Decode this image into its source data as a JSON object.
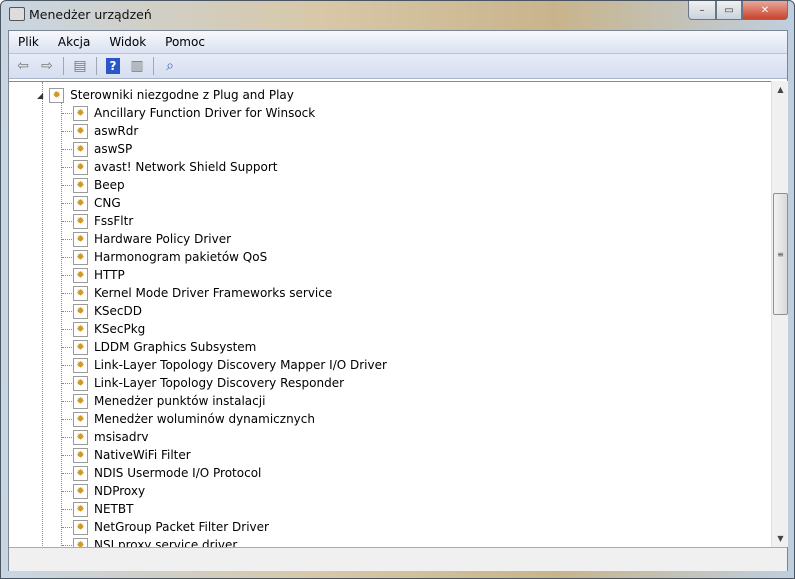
{
  "window": {
    "title": "Menedżer urządzeń",
    "minimize": "–",
    "maximize": "▭",
    "close": "✕"
  },
  "menu": [
    "Plik",
    "Akcja",
    "Widok",
    "Pomoc"
  ],
  "toolbar": {
    "icons": [
      "back-arrow-icon",
      "forward-arrow-icon",
      "show-hide-console-tree-icon",
      "help-icon",
      "action-pane-icon",
      "scan-hardware-icon"
    ],
    "help_label": "?"
  },
  "tree": {
    "category": "Sterowniki niezgodne z Plug and Play",
    "items": [
      "Ancillary Function Driver for Winsock",
      "aswRdr",
      "aswSP",
      "avast! Network Shield Support",
      "Beep",
      "CNG",
      "FssFltr",
      "Hardware Policy Driver",
      "Harmonogram pakietów QoS",
      "HTTP",
      "Kernel Mode Driver Frameworks service",
      "KSecDD",
      "KSecPkg",
      "LDDM Graphics Subsystem",
      "Link-Layer Topology Discovery Mapper I/O Driver",
      "Link-Layer Topology Discovery Responder",
      "Menedżer punktów instalacji",
      "Menedżer woluminów dynamicznych",
      "msisadrv",
      "NativeWiFi Filter",
      "NDIS Usermode I/O Protocol",
      "NDProxy",
      "NETBT",
      "NetGroup Packet Filter Driver",
      "NSI proxy service driver."
    ]
  },
  "scrollbar": {
    "up": "▲",
    "down": "▼",
    "grip": "≡"
  },
  "status": ""
}
